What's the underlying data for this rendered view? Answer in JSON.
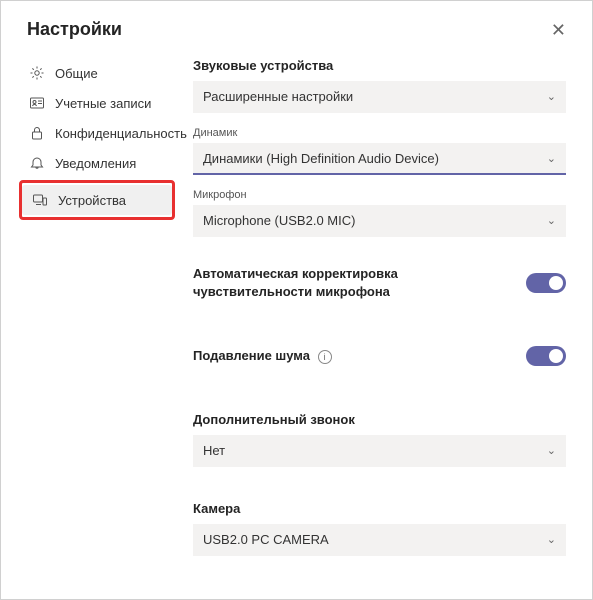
{
  "header": {
    "title": "Настройки"
  },
  "sidebar": {
    "items": [
      {
        "label": "Общие"
      },
      {
        "label": "Учетные записи"
      },
      {
        "label": "Конфиденциальность"
      },
      {
        "label": "Уведомления"
      },
      {
        "label": "Устройства"
      }
    ]
  },
  "main": {
    "audio_devices_title": "Звуковые устройства",
    "audio_devices_select": "Расширенные настройки",
    "speaker_label": "Динамик",
    "speaker_select": "Динамики (High Definition Audio Device)",
    "mic_label": "Микрофон",
    "mic_select": "Microphone (USB2.0 MIC)",
    "auto_gain_label": "Автоматическая корректировка чувствительности микрофона",
    "noise_suppress_label": "Подавление шума",
    "secondary_ringer_title": "Дополнительный звонок",
    "secondary_ringer_select": "Нет",
    "camera_title": "Камера",
    "camera_select": "USB2.0 PC CAMERA"
  },
  "toggles": {
    "auto_gain": true,
    "noise_suppress": true
  },
  "colors": {
    "accent": "#6264a7",
    "highlight": "#e83030"
  }
}
